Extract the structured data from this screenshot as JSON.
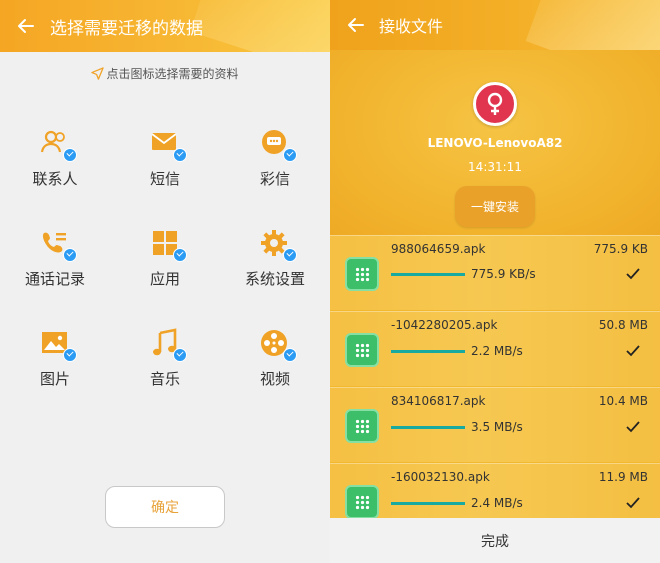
{
  "left": {
    "title": "选择需要迁移的数据",
    "hint": "点击图标选择需要的资料",
    "items": [
      {
        "label": "联系人",
        "icon": "contacts-icon"
      },
      {
        "label": "短信",
        "icon": "sms-icon"
      },
      {
        "label": "彩信",
        "icon": "mms-icon"
      },
      {
        "label": "通话记录",
        "icon": "call-log-icon"
      },
      {
        "label": "应用",
        "icon": "apps-icon"
      },
      {
        "label": "系统设置",
        "icon": "settings-icon"
      },
      {
        "label": "图片",
        "icon": "pictures-icon"
      },
      {
        "label": "音乐",
        "icon": "music-icon"
      },
      {
        "label": "视频",
        "icon": "video-icon"
      }
    ],
    "confirm_label": "确定"
  },
  "right": {
    "title": "接收文件",
    "device_name": "LENOVO-LenovoA82",
    "time": "14:31:11",
    "install_label": "一键安装",
    "files": [
      {
        "name": "988064659.apk",
        "size": "775.9 KB",
        "speed": "775.9 KB/s"
      },
      {
        "name": "-1042280205.apk",
        "size": "50.8 MB",
        "speed": "2.2 MB/s"
      },
      {
        "name": "834106817.apk",
        "size": "10.4 MB",
        "speed": "3.5 MB/s"
      },
      {
        "name": "-160032130.apk",
        "size": "11.9 MB",
        "speed": "2.4 MB/s"
      }
    ],
    "done_label": "完成"
  },
  "colors": {
    "accent": "#f5a623",
    "icon_orange": "#f0a226",
    "check_blue": "#2b9bf4",
    "progress": "#18a9a0",
    "app_green": "#3dbf6a",
    "avatar_red": "#e0344f"
  }
}
